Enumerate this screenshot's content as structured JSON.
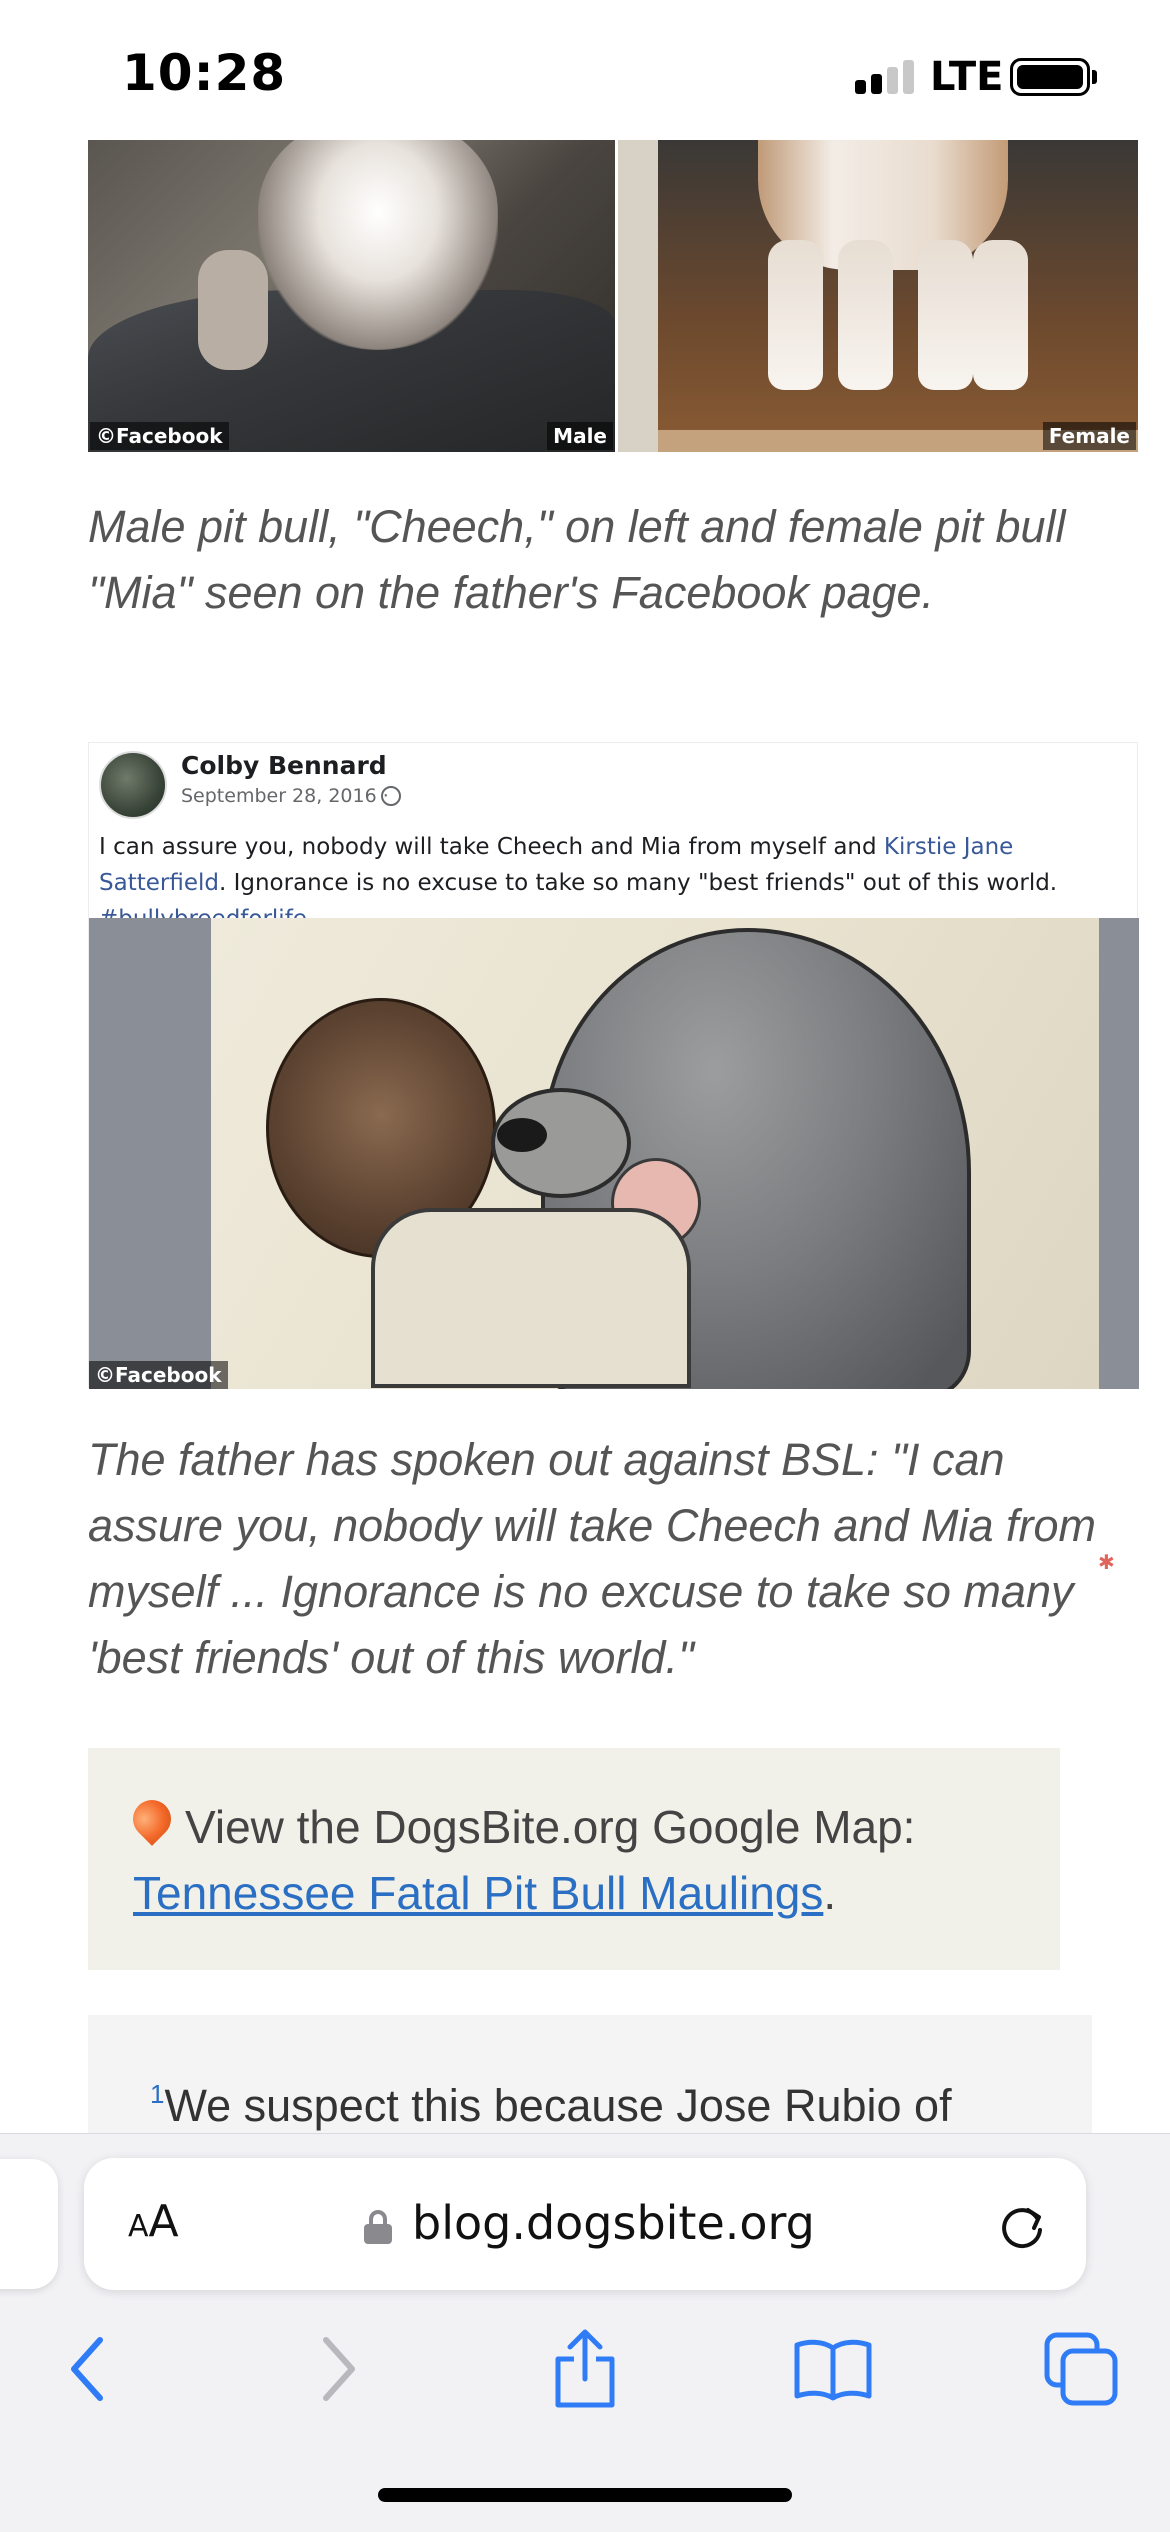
{
  "status_bar": {
    "time": "10:28",
    "network": "LTE",
    "signal_bars_active": 2,
    "signal_bars_total": 4
  },
  "article": {
    "photo_pair": {
      "watermark": "©Facebook",
      "left_tag": "Male",
      "right_tag": "Female"
    },
    "caption_1": "Male pit bull, \"Cheech,\" on left and female pit bull \"Mia\" seen on the father's Facebook page.",
    "facebook_post": {
      "author": "Colby Bennard",
      "date": "September 28, 2016 ·",
      "text_1": "I can assure you, nobody will take Cheech and Mia from myself and ",
      "link_1": "Kirstie Jane Satterfield",
      "text_2": ". Ignorance is no excuse to take so many \"best friends\" out of this world. ",
      "link_2": "#bullybreedforlife",
      "watermark": "©Facebook"
    },
    "caption_2": "The father has spoken out against BSL: \"I can assure you, nobody will take Cheech and Mia from myself ... Ignorance is no excuse to take so many 'best friends' out of this world.\"",
    "map_box": {
      "label": "View the DogsBite.org Google Map:",
      "link": "Tennessee Fatal Pit Bull Maulings",
      "trailing": "."
    },
    "footnote": {
      "marker": "1",
      "text": "We suspect this because Jose Rubio of"
    }
  },
  "browser": {
    "aa_small": "A",
    "aa_large": "A",
    "url": "blog.dogsbite.org",
    "accent_color": "#2f7cf6"
  }
}
